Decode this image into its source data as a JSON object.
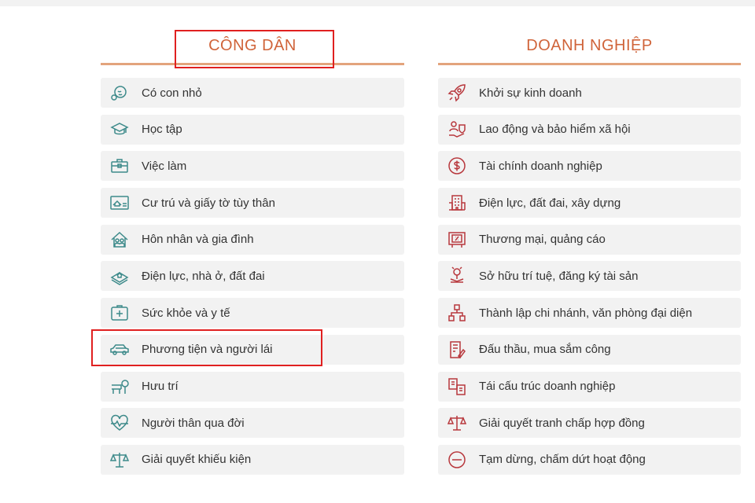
{
  "cong_dan": {
    "title": "CÔNG DÂN",
    "items": [
      {
        "label": "Có con nhỏ",
        "icon": "baby-icon"
      },
      {
        "label": "Học tập",
        "icon": "graduation-cap-icon"
      },
      {
        "label": "Việc làm",
        "icon": "briefcase-icon"
      },
      {
        "label": "Cư trú và giấy tờ tùy thân",
        "icon": "id-card-icon"
      },
      {
        "label": "Hôn nhân và gia đình",
        "icon": "family-home-icon"
      },
      {
        "label": "Điện lực, nhà ở, đất đai",
        "icon": "land-icon"
      },
      {
        "label": "Sức khỏe và y tế",
        "icon": "medical-cross-icon"
      },
      {
        "label": "Phương tiện và người lái",
        "icon": "car-icon"
      },
      {
        "label": "Hưu trí",
        "icon": "retirement-bench-icon"
      },
      {
        "label": "Người thân qua đời",
        "icon": "heartbeat-icon"
      },
      {
        "label": "Giải quyết khiếu kiện",
        "icon": "scales-icon"
      }
    ]
  },
  "doanh_nghiep": {
    "title": "DOANH NGHIỆP",
    "items": [
      {
        "label": "Khởi sự kinh doanh",
        "icon": "rocket-icon"
      },
      {
        "label": "Lao động và bảo hiểm xã hội",
        "icon": "worker-insurance-icon"
      },
      {
        "label": "Tài chính doanh nghiệp",
        "icon": "dollar-icon"
      },
      {
        "label": "Điện lực, đất đai, xây dựng",
        "icon": "building-icon"
      },
      {
        "label": "Thương mại, quảng cáo",
        "icon": "billboard-icon"
      },
      {
        "label": "Sở hữu trí tuệ, đăng ký tài sản",
        "icon": "intellectual-property-icon"
      },
      {
        "label": "Thành lập chi nhánh, văn phòng đại diện",
        "icon": "org-chart-icon"
      },
      {
        "label": "Đấu thầu, mua sắm công",
        "icon": "bidding-document-icon"
      },
      {
        "label": "Tái cấu trúc doanh nghiệp",
        "icon": "restructure-icon"
      },
      {
        "label": "Giải quyết tranh chấp hợp đồng",
        "icon": "scales-icon"
      },
      {
        "label": "Tạm dừng, chấm dứt hoạt động",
        "icon": "minus-circle-icon"
      }
    ]
  },
  "colors": {
    "heading": "#d0643a",
    "heading_underline": "#e3a47c",
    "cong_dan_icon": "#3d8a8a",
    "doanh_nghiep_icon": "#b8383d",
    "highlight_box": "#e02020",
    "item_background": "#f2f2f2"
  }
}
